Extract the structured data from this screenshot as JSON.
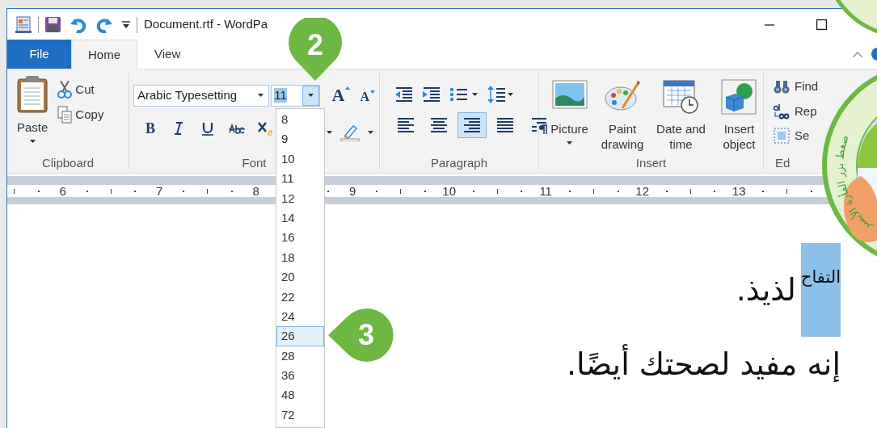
{
  "window": {
    "title": "Document.rtf - WordPa"
  },
  "tabs": [
    {
      "label": "File",
      "selected": false,
      "kind": "file"
    },
    {
      "label": "Home",
      "selected": true,
      "kind": "tab"
    },
    {
      "label": "View",
      "selected": false,
      "kind": "tab"
    }
  ],
  "clipboard": {
    "label": "Clipboard",
    "paste": "Paste",
    "cut": "Cut",
    "copy": "Copy"
  },
  "font": {
    "label": "Font",
    "font_name": "Arabic Typesetting",
    "font_size": "11",
    "expanded": true,
    "grow_label": "A",
    "shrink_label": "A",
    "bold_label": "B",
    "size_list": [
      {
        "label": "8",
        "selected": false
      },
      {
        "label": "9",
        "selected": false
      },
      {
        "label": "10",
        "selected": false
      },
      {
        "label": "11",
        "selected": false
      },
      {
        "label": "12",
        "selected": false
      },
      {
        "label": "14",
        "selected": false
      },
      {
        "label": "16",
        "selected": false
      },
      {
        "label": "18",
        "selected": false
      },
      {
        "label": "20",
        "selected": false
      },
      {
        "label": "22",
        "selected": false
      },
      {
        "label": "24",
        "selected": false
      },
      {
        "label": "26",
        "selected": true
      },
      {
        "label": "28",
        "selected": false
      },
      {
        "label": "36",
        "selected": false
      },
      {
        "label": "48",
        "selected": false
      },
      {
        "label": "72",
        "selected": false
      }
    ]
  },
  "paragraph": {
    "label": "Paragraph",
    "alignment": [
      {
        "kind": "left",
        "selected": false
      },
      {
        "kind": "center",
        "selected": false
      },
      {
        "kind": "right",
        "selected": true
      },
      {
        "kind": "justify",
        "selected": false
      }
    ]
  },
  "insert": {
    "label": "Insert",
    "buttons": [
      {
        "kind": "picture",
        "label": "Picture"
      },
      {
        "kind": "paint",
        "label": "Paint drawing"
      },
      {
        "kind": "datetime",
        "label": "Date and time"
      },
      {
        "kind": "object",
        "label": "Insert object"
      }
    ]
  },
  "editing": {
    "label": "Ed",
    "items": [
      {
        "kind": "find",
        "label": "Find"
      },
      {
        "kind": "replace",
        "label": "Rep"
      },
      {
        "kind": "select",
        "label": "Se"
      }
    ]
  },
  "ruler": [
    "6",
    "7",
    "8",
    "9",
    "10",
    "11",
    "12",
    "13"
  ],
  "document": [
    {
      "segments": [
        {
          "text": "التفاح",
          "selected": true
        },
        {
          "text": "لذيذ.",
          "selected": false
        }
      ]
    },
    {
      "segments": [
        {
          "text": "إنه مفيد لصحتك أيضًا.",
          "selected": false
        }
      ]
    }
  ],
  "callouts": [
    {
      "label": "2",
      "kind": "down"
    },
    {
      "label": "3",
      "kind": "left"
    }
  ],
  "badge": {
    "text": "ضغط بزر الفأرة الأيسر"
  }
}
